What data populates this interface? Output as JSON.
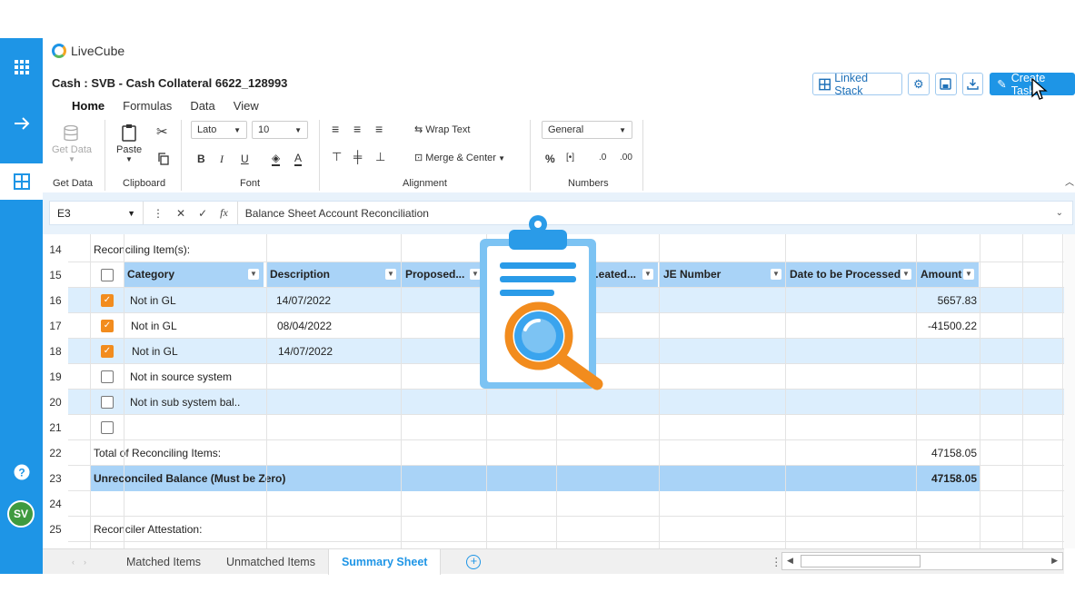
{
  "app": {
    "name": "LiveCube"
  },
  "document": {
    "title": "Cash : SVB - Cash Collateral 6622_128993"
  },
  "menu": [
    "Home",
    "Formulas",
    "Data",
    "View"
  ],
  "actions": {
    "linked_stack": "Linked Stack",
    "create_task": "Create Task"
  },
  "ribbon": {
    "get_data": "Get Data",
    "get_data_group": "Get Data",
    "paste": "Paste",
    "clipboard_group": "Clipboard",
    "font_name": "Lato",
    "font_size": "10",
    "font_group": "Font",
    "wrap_text": "Wrap Text",
    "merge_center": "Merge & Center",
    "alignment_group": "Alignment",
    "number_format": "General",
    "numbers_group": "Numbers"
  },
  "formula_bar": {
    "cell_ref": "E3",
    "value": "Balance Sheet Account Reconciliation"
  },
  "sheet": {
    "row14_label": "Reconciling Item(s):",
    "headers": [
      "Category",
      "Description",
      "Proposed...",
      "...eated...",
      "JE Number",
      "Date to be Processed",
      "Amount"
    ],
    "items": [
      {
        "row": "16",
        "checked": true,
        "category": "Not in GL",
        "description": "14/07/2022",
        "amount": "5657.83"
      },
      {
        "row": "17",
        "checked": true,
        "category": "Not in GL",
        "description": "08/04/2022",
        "amount": "-41500.22"
      },
      {
        "row": "18",
        "checked": true,
        "category": "Not in GL",
        "description": "14/07/2022",
        "amount": ""
      },
      {
        "row": "19",
        "checked": false,
        "category": "Not in source system",
        "description": "",
        "amount": ""
      },
      {
        "row": "20",
        "checked": false,
        "category": "Not in sub system bal..",
        "description": "",
        "amount": ""
      },
      {
        "row": "21",
        "checked": false,
        "category": "",
        "description": "",
        "amount": ""
      }
    ],
    "total_label": "Total of Reconciling Items:",
    "total_value": "47158.05",
    "unreconciled_label": "Unreconciled Balance (Must be Zero)",
    "unreconciled_value": "47158.05",
    "attestation_label": "Reconciler Attestation:",
    "row_numbers": [
      "14",
      "15",
      "16",
      "17",
      "18",
      "19",
      "20",
      "21",
      "22",
      "23",
      "24",
      "25"
    ]
  },
  "tabs": [
    "Matched Items",
    "Unmatched Items",
    "Summary Sheet"
  ],
  "active_tab": "Summary Sheet",
  "user": {
    "initials": "SV"
  },
  "colors": {
    "accent": "#1e95e6",
    "checkbox": "#f28c1e",
    "header": "#a9d3f7"
  }
}
